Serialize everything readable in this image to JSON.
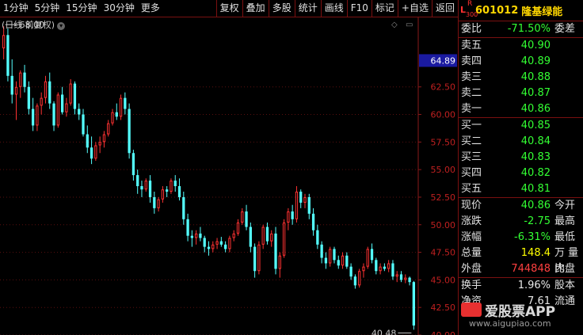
{
  "toolbar": {
    "left": [
      "1分钟",
      "5分钟",
      "15分钟",
      "30分钟",
      "更多"
    ],
    "right": [
      "复权",
      "叠加",
      "多股",
      "统计",
      "画线",
      "F10",
      "标记",
      "+自选",
      "返回"
    ]
  },
  "chart_header": {
    "title": "(日线 前复权)"
  },
  "chart_data": {
    "type": "candlestick",
    "yticks": [
      "62.50",
      "60.00",
      "57.50",
      "55.00",
      "52.50",
      "50.00",
      "47.50",
      "45.00",
      "42.50",
      "40.00"
    ],
    "ytick_values": [
      62.5,
      60,
      57.5,
      55,
      52.5,
      50,
      47.5,
      45,
      42.5,
      40
    ],
    "ylim": [
      40,
      68.8
    ],
    "high_label": "68.00",
    "low_label": "40.48",
    "current_label": "64.89",
    "partial_tick": "65.00",
    "candles": [
      [
        66,
        68,
        65,
        67.2
      ],
      [
        67.2,
        67.8,
        63,
        63.5
      ],
      [
        63.5,
        65,
        61,
        61.8
      ],
      [
        61.8,
        63,
        59.5,
        62.5
      ],
      [
        62.5,
        64,
        61.5,
        63.8
      ],
      [
        63.8,
        64.5,
        62,
        62.5
      ],
      [
        62.5,
        63,
        60,
        60.5
      ],
      [
        60.5,
        61.5,
        58.5,
        59
      ],
      [
        59,
        61,
        58.5,
        60.8
      ],
      [
        60.8,
        62,
        60,
        61.5
      ],
      [
        61.5,
        63.5,
        61,
        63
      ],
      [
        63,
        63.8,
        60.5,
        61
      ],
      [
        61,
        61.2,
        58.5,
        59
      ],
      [
        59,
        62,
        58.8,
        61.8
      ],
      [
        61.8,
        62.5,
        60,
        60.2
      ],
      [
        60.2,
        61.5,
        59.8,
        61
      ],
      [
        61,
        63.2,
        60.8,
        62.8
      ],
      [
        62.8,
        63,
        60,
        60.5
      ],
      [
        60.5,
        61,
        59.5,
        60
      ],
      [
        60,
        60.5,
        58,
        58.2
      ],
      [
        58.2,
        59,
        56.5,
        57
      ],
      [
        57,
        58,
        55.5,
        56
      ],
      [
        56,
        57.5,
        55.8,
        57.2
      ],
      [
        57.2,
        58,
        56.5,
        57.5
      ],
      [
        57.5,
        58.5,
        57,
        58.2
      ],
      [
        58.2,
        59.5,
        58,
        59.2
      ],
      [
        59.2,
        60.5,
        59,
        60.2
      ],
      [
        60.2,
        61,
        59.5,
        59.8
      ],
      [
        59.8,
        61.8,
        59.5,
        61.5
      ],
      [
        61.5,
        62,
        60,
        60.5
      ],
      [
        60.5,
        61,
        56,
        56.5
      ],
      [
        56.5,
        56.8,
        54,
        54.5
      ],
      [
        54.5,
        55,
        52.8,
        53.5
      ],
      [
        53.5,
        54,
        52.5,
        53.2
      ],
      [
        53.2,
        54.2,
        53,
        54
      ],
      [
        54,
        54.5,
        52,
        52.5
      ],
      [
        52.5,
        53,
        51,
        51.5
      ],
      [
        51.5,
        52.5,
        51.2,
        52.3
      ],
      [
        52.3,
        53.5,
        52,
        53.2
      ],
      [
        53.2,
        53.5,
        52.5,
        53
      ],
      [
        53,
        54.2,
        52.8,
        54
      ],
      [
        54,
        54.5,
        53,
        53.5
      ],
      [
        53.5,
        54.2,
        52.2,
        52.5
      ],
      [
        52.5,
        53,
        50,
        50.5
      ],
      [
        50.5,
        51,
        48.5,
        49
      ],
      [
        49,
        49.5,
        48,
        48.8
      ],
      [
        48.8,
        49.5,
        48.2,
        49.2
      ],
      [
        49.2,
        49.8,
        48.5,
        48.8
      ],
      [
        48.8,
        49,
        47.5,
        48
      ],
      [
        48,
        48.5,
        47.2,
        47.8
      ],
      [
        47.8,
        48.5,
        47.5,
        48.2
      ],
      [
        48.2,
        48.8,
        47.8,
        48.5
      ],
      [
        48.5,
        48.9,
        48,
        48.2
      ],
      [
        48.2,
        48.5,
        47.5,
        47.8
      ],
      [
        47.8,
        49,
        47.5,
        48.8
      ],
      [
        48.8,
        49.5,
        48.5,
        49.2
      ],
      [
        49.2,
        50.5,
        49,
        50.2
      ],
      [
        50.2,
        51.5,
        50,
        51.2
      ],
      [
        51.2,
        51.8,
        49.5,
        49.8
      ],
      [
        49.8,
        50.2,
        47.5,
        48
      ],
      [
        48,
        48.3,
        45.2,
        45.8
      ],
      [
        45.8,
        48.5,
        45.5,
        48.2
      ],
      [
        48.2,
        50,
        47.8,
        49.8
      ],
      [
        49.8,
        50.2,
        48.2,
        48.5
      ],
      [
        48.5,
        49.5,
        48,
        49.2
      ],
      [
        49.2,
        49.8,
        45.5,
        46
      ],
      [
        46,
        47.5,
        45.2,
        47.2
      ],
      [
        47.2,
        50.5,
        47,
        50.2
      ],
      [
        50.2,
        51.5,
        49.5,
        51.2
      ],
      [
        51.2,
        51.8,
        50,
        50.5
      ],
      [
        50.5,
        53.5,
        50.2,
        53
      ],
      [
        53,
        53.2,
        51.5,
        52
      ],
      [
        52,
        52.8,
        51.5,
        52.5
      ],
      [
        52.5,
        52.8,
        50.5,
        51
      ],
      [
        51,
        51.5,
        49,
        49.5
      ],
      [
        49.5,
        50,
        47.8,
        48.2
      ],
      [
        48.2,
        48.5,
        46.5,
        47
      ],
      [
        47,
        47.5,
        46,
        46.5
      ],
      [
        46.5,
        48,
        46.2,
        47.8
      ],
      [
        47.8,
        48,
        46.5,
        46.8
      ],
      [
        46.8,
        47.2,
        46,
        46.3
      ],
      [
        46.3,
        47.5,
        46,
        47.2
      ],
      [
        47.2,
        47.5,
        46,
        46.2
      ],
      [
        46.2,
        46.5,
        45,
        45.3
      ],
      [
        45.3,
        45.5,
        44.2,
        44.5
      ],
      [
        44.5,
        46,
        44.3,
        45.8
      ],
      [
        45.8,
        46.5,
        45.2,
        46.2
      ],
      [
        46.2,
        48,
        46,
        47.8
      ],
      [
        47.8,
        48.3,
        46.5,
        46.8
      ],
      [
        46.8,
        47,
        45.5,
        45.8
      ],
      [
        45.8,
        46.5,
        45.5,
        46.2
      ],
      [
        46.2,
        46.5,
        45.8,
        46
      ],
      [
        46,
        46.8,
        45.7,
        46.5
      ],
      [
        46.5,
        46.8,
        45,
        45.3
      ],
      [
        45.3,
        45.8,
        44.8,
        45.5
      ],
      [
        45.5,
        45.8,
        44.8,
        45
      ],
      [
        45,
        45.5,
        44.7,
        45.2
      ],
      [
        45.2,
        45.3,
        44.5,
        44.8
      ],
      [
        44.8,
        44.9,
        40.48,
        40.86
      ]
    ]
  },
  "panel": {
    "code": "601012",
    "name": "隆基绿能",
    "badge_l": "L",
    "badge_r": "R",
    "badge_n": "300",
    "weibi": {
      "label": "委比",
      "value": "-71.50%",
      "label2": "委差"
    },
    "sells": [
      {
        "label": "卖五",
        "price": "40.90"
      },
      {
        "label": "卖四",
        "price": "40.89"
      },
      {
        "label": "卖三",
        "price": "40.88"
      },
      {
        "label": "卖二",
        "price": "40.87"
      },
      {
        "label": "卖一",
        "price": "40.86"
      }
    ],
    "buys": [
      {
        "label": "买一",
        "price": "40.85"
      },
      {
        "label": "买二",
        "price": "40.84"
      },
      {
        "label": "买三",
        "price": "40.83"
      },
      {
        "label": "买四",
        "price": "40.82"
      },
      {
        "label": "买五",
        "price": "40.81"
      }
    ],
    "stats": [
      {
        "label": "现价",
        "value": "40.86",
        "label2": "今开",
        "color": "green"
      },
      {
        "label": "涨跌",
        "value": "-2.75",
        "label2": "最高",
        "color": "green"
      },
      {
        "label": "涨幅",
        "value": "-6.31%",
        "label2": "最低",
        "color": "green"
      },
      {
        "label": "总量",
        "value": "148.4",
        "label2": "万 量比",
        "color": "yellow"
      },
      {
        "label": "外盘",
        "value": "744848",
        "label2": "内盘",
        "color": "red"
      }
    ],
    "extra": [
      {
        "label": "换手",
        "value": "1.96%",
        "label2": "股本",
        "color": "white"
      },
      {
        "label": "净资",
        "value": "7.61",
        "label2": "流通",
        "color": "white"
      }
    ]
  },
  "watermark": {
    "text": "爱股票APP",
    "url": "www.aigupiao.com"
  }
}
